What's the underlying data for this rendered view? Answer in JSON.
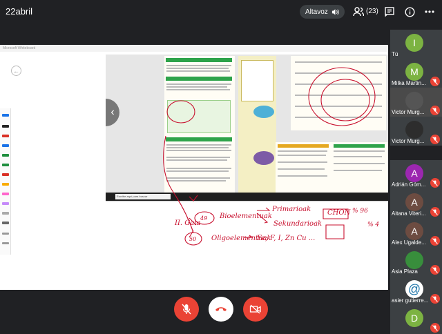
{
  "meeting": {
    "title": "22abril"
  },
  "speaker": {
    "label": "Altavoz"
  },
  "participants_count": "(23)",
  "shared_screen": {
    "window_title": "Microsoft Whiteboard",
    "taskbar_search": "Escribe aquí para buscar"
  },
  "handwriting": {
    "line1": "II. Gaia",
    "line1_item": "Bioelementuak",
    "primarioak": "Primarioak",
    "chon": "CHON",
    "pct96": "% 96",
    "sekundarioak": "Sekundarioak",
    "pct4": "% 4",
    "line2": "Oligoelementuak",
    "elements": "Fe; F, I, Zn Cu ..."
  },
  "participant_list": [
    {
      "initial": "I",
      "name": "Tú",
      "color": "#7cb342"
    },
    {
      "initial": "M",
      "name": "Milka Martin...",
      "color": "#7cb342"
    },
    {
      "initial": "",
      "name": "Victor Murg...",
      "color": "#555555"
    },
    {
      "initial": "",
      "name": "Victor Murg...",
      "color": "#2d2d2d"
    },
    {
      "initial": "A",
      "name": "Adrián Góm...",
      "color": "#9c27b0"
    },
    {
      "initial": "A",
      "name": "Aitana Viteri...",
      "color": "#6d4c41"
    },
    {
      "initial": "A",
      "name": "Alex Ugalde...",
      "color": "#6d4c41"
    },
    {
      "initial": "",
      "name": "Asia Plaza",
      "color": "#388e3c"
    },
    {
      "initial": "@",
      "name": "asier gutierre...",
      "color": "#ffffff"
    },
    {
      "initial": "D",
      "name": "",
      "color": "#7cb342"
    }
  ],
  "colors": {
    "end_call": "#ea4335",
    "muted": "#ea4335",
    "background": "#202124"
  }
}
